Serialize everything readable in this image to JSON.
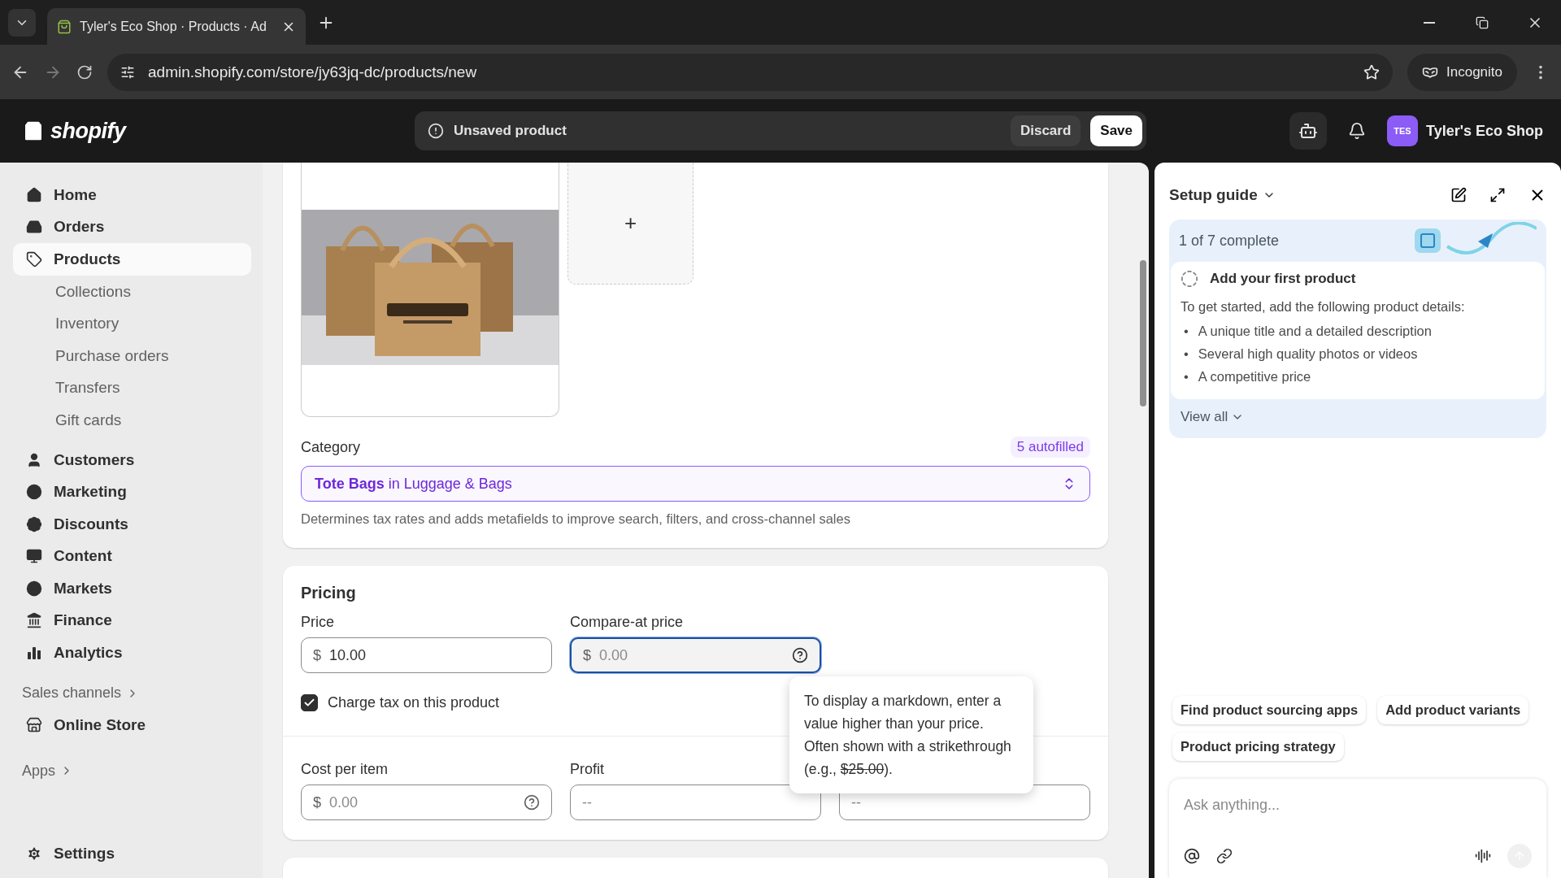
{
  "browser": {
    "tab_title": "Tyler's Eco Shop · Products · Ad",
    "url": "admin.shopify.com/store/jy63jq-dc/products/new",
    "profile": "Incognito"
  },
  "topbar": {
    "logo": "shopify",
    "status": "Unsaved product",
    "discard": "Discard",
    "save": "Save",
    "store_badge": "TES",
    "store_name": "Tyler's Eco Shop"
  },
  "sidebar": {
    "items": [
      {
        "label": "Home",
        "selected": false
      },
      {
        "label": "Orders",
        "selected": false
      },
      {
        "label": "Products",
        "selected": true,
        "children": [
          {
            "label": "Collections"
          },
          {
            "label": "Inventory"
          },
          {
            "label": "Purchase orders"
          },
          {
            "label": "Transfers"
          },
          {
            "label": "Gift cards"
          }
        ]
      },
      {
        "label": "Customers",
        "selected": false
      },
      {
        "label": "Marketing",
        "selected": false
      },
      {
        "label": "Discounts",
        "selected": false
      },
      {
        "label": "Content",
        "selected": false
      },
      {
        "label": "Markets",
        "selected": false
      },
      {
        "label": "Finance",
        "selected": false
      },
      {
        "label": "Analytics",
        "selected": false
      }
    ],
    "sales_channels": {
      "label": "Sales channels",
      "items": [
        {
          "label": "Online Store",
          "selected": false
        }
      ]
    },
    "apps": {
      "label": "Apps"
    },
    "settings": {
      "label": "Settings"
    }
  },
  "media": {
    "add_label": "+"
  },
  "category": {
    "label": "Category",
    "badge": "5 autofilled",
    "value": "**Tote Bags** in Luggage & Bags",
    "help": "Determines tax rates and adds metafields to improve search, filters, and cross-channel sales"
  },
  "pricing": {
    "title": "Pricing",
    "price_fields": [
      {
        "label": "Price",
        "prefix": "$",
        "value": "10.00",
        "focused": false
      },
      {
        "label": "Compare-at price",
        "prefix": "$",
        "placeholder": "0.00",
        "focused": true
      }
    ],
    "charge_tax": {
      "label": "Charge tax on this product",
      "checked": true
    },
    "cost_fields": [
      {
        "label": "Cost per item",
        "prefix": "$",
        "placeholder": "0.00",
        "help": true
      },
      {
        "label": "Profit",
        "placeholder": "--",
        "help": false
      },
      {
        "placeholder": "--",
        "help": false
      }
    ],
    "tooltip": {
      "text": "To display a markdown, enter a value higher than your price. Often shown with a strikethrough (e.g., ",
      "struck": "$25.00",
      "after": ")."
    }
  },
  "setup_guide": {
    "title": "Setup guide",
    "progress": "1 of 7 complete",
    "task": {
      "title": "Add your first product",
      "done": false,
      "intro": "To get started, add the following product details:",
      "bullet_marker": "•",
      "bullets": [
        "A unique title and a detailed description",
        "Several high quality photos or videos",
        "A competitive price"
      ]
    },
    "view_all": "View all",
    "suggestions": [
      "Find product sourcing apps",
      "Add product variants",
      "Product pricing strategy"
    ],
    "ask_placeholder": "Ask anything..."
  }
}
